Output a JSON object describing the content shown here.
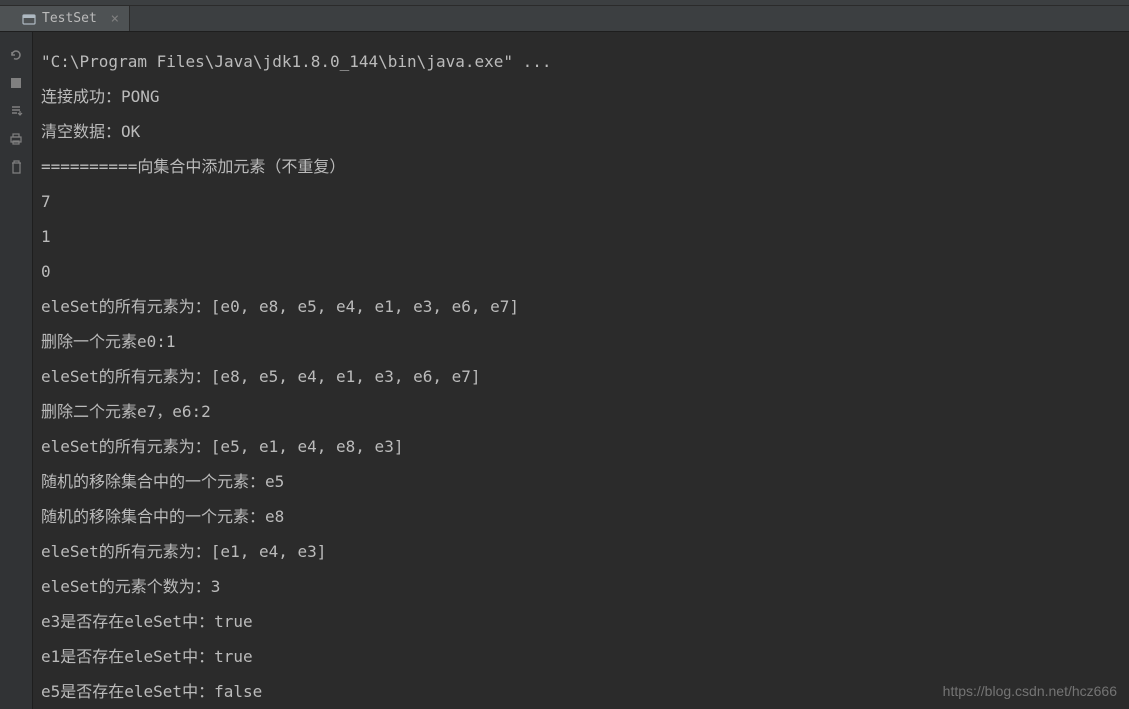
{
  "tab": {
    "label": "TestSet",
    "close": "×"
  },
  "console": {
    "lines": [
      "\"C:\\Program Files\\Java\\jdk1.8.0_144\\bin\\java.exe\" ...",
      "连接成功：PONG",
      "清空数据：OK",
      "==========向集合中添加元素（不重复）",
      "7",
      "1",
      "0",
      "eleSet的所有元素为：[e0, e8, e5, e4, e1, e3, e6, e7]",
      "删除一个元素e0:1",
      "eleSet的所有元素为：[e8, e5, e4, e1, e3, e6, e7]",
      "删除二个元素e7，e6:2",
      "eleSet的所有元素为：[e5, e1, e4, e8, e3]",
      "随机的移除集合中的一个元素：e5",
      "随机的移除集合中的一个元素：e8",
      "eleSet的所有元素为：[e1, e4, e3]",
      "eleSet的元素个数为：3",
      "e3是否存在eleSet中：true",
      "e1是否存在eleSet中：true",
      "e5是否存在eleSet中：false"
    ]
  },
  "watermark": "https://blog.csdn.net/hcz666"
}
